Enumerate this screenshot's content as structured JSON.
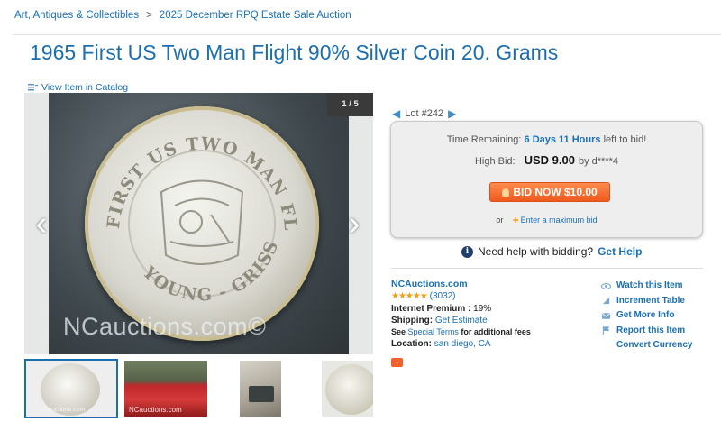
{
  "breadcrumb": {
    "items": [
      "Art, Antiques & Collectibles",
      "2025 December RPQ Estate Sale Auction"
    ],
    "separator": ">"
  },
  "item": {
    "title": "1965 First US Two Man Flight 90% Silver Coin 20. Grams",
    "catalog_link": "View Item in Catalog"
  },
  "gallery": {
    "counter": "1 / 5",
    "watermark": "NCauctions.com©",
    "coin_top_text": "FIRST US TWO MAN FLIGHT",
    "coin_bottom_text": "YOUNG - GRISSOM",
    "thumb_watermark": "NCauctions.com"
  },
  "lot": {
    "label": "Lot #242"
  },
  "bidding": {
    "time_label": "Time Remaining:",
    "time_value": "6 Days 11 Hours",
    "time_suffix": "left to bid!",
    "high_bid_label": "High Bid:",
    "high_bid_amount": "USD 9.00",
    "high_bid_by": "by d****4",
    "bid_button": "BID NOW $10.00",
    "or_label": "or",
    "max_bid_link": "Enter a maximum bid"
  },
  "help": {
    "text": "Need help with bidding?",
    "link": "Get Help"
  },
  "seller": {
    "name": "NCAuctions.com",
    "stars": "★★★★★",
    "rating_count": "(3032)",
    "premium_label": "Internet Premium :",
    "premium_value": "19%",
    "shipping_label": "Shipping:",
    "shipping_link": "Get Estimate",
    "see_label": "See",
    "terms_link": "Special Terms",
    "terms_suffix": "for additional fees",
    "location_label": "Location:",
    "location_value": "san diego, CA"
  },
  "actions": {
    "watch": "Watch this Item",
    "increment": "Increment Table",
    "more_info": "Get More Info",
    "report": "Report this Item",
    "currency": "Convert Currency"
  },
  "colors": {
    "link": "#1a6fb5",
    "title": "#1b6fae",
    "bid_button": "#ef5a1c",
    "stars": "#f0a019"
  }
}
